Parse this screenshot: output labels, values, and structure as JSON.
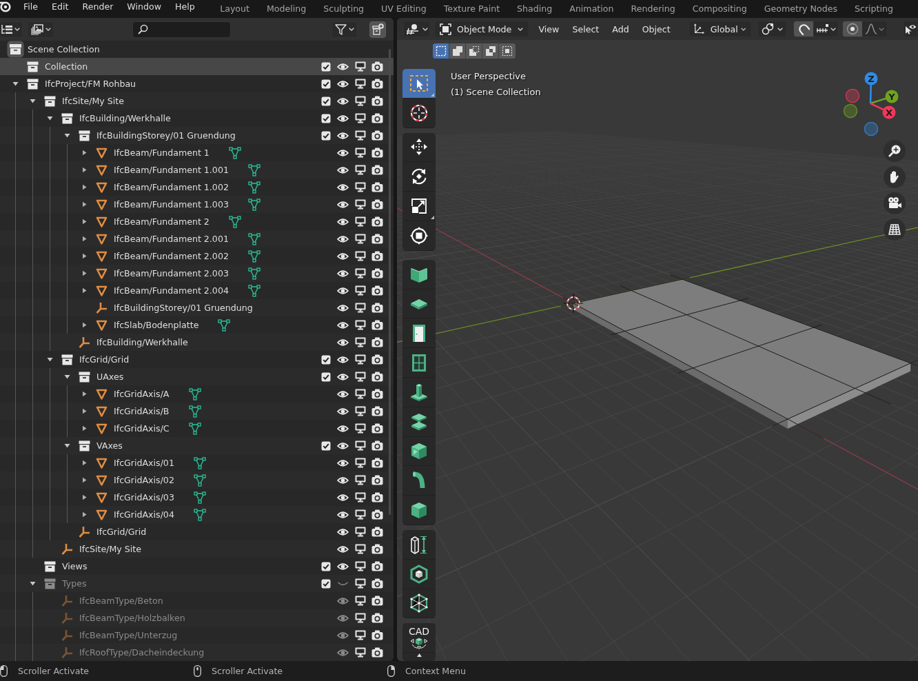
{
  "topbar": {
    "menus": [
      "File",
      "Edit",
      "Render",
      "Window",
      "Help"
    ],
    "workspaces": [
      {
        "label": "Layout",
        "selected": false
      },
      {
        "label": "Modeling",
        "selected": false
      },
      {
        "label": "Sculpting",
        "selected": false
      },
      {
        "label": "UV Editing",
        "selected": false
      },
      {
        "label": "Texture Paint",
        "selected": false
      },
      {
        "label": "Shading",
        "selected": false
      },
      {
        "label": "Animation",
        "selected": false
      },
      {
        "label": "Rendering",
        "selected": false
      },
      {
        "label": "Compositing",
        "selected": false
      },
      {
        "label": "Geometry Nodes",
        "selected": false
      },
      {
        "label": "Scripting",
        "selected": false
      }
    ]
  },
  "outliner": {
    "tree": [
      {
        "name": "Scene Collection",
        "kind": "scene",
        "selected": false,
        "children": [
          {
            "name": "Collection",
            "kind": "collection",
            "selected": true,
            "checked": true,
            "visible": true
          },
          {
            "name": "IfcProject/FM Rohbau",
            "kind": "collection",
            "selected": false,
            "expanded": true,
            "checked": true,
            "visible": true,
            "children": [
              {
                "name": "IfcSite/My Site",
                "kind": "collection",
                "selected": false,
                "expanded": true,
                "checked": true,
                "visible": true,
                "children": [
                  {
                    "name": "IfcBuilding/Werkhalle",
                    "kind": "collection",
                    "selected": false,
                    "expanded": true,
                    "checked": true,
                    "visible": true,
                    "children": [
                      {
                        "name": "IfcBuildingStorey/01 Gruendung",
                        "kind": "collection",
                        "selected": false,
                        "expanded": true,
                        "checked": true,
                        "visible": true,
                        "children": [
                          {
                            "name": "IfcBeam/Fundament 1",
                            "kind": "mesh",
                            "selected": false,
                            "expanded": false,
                            "visible": true
                          },
                          {
                            "name": "IfcBeam/Fundament 1.001",
                            "kind": "mesh",
                            "selected": false,
                            "expanded": false,
                            "visible": true
                          },
                          {
                            "name": "IfcBeam/Fundament 1.002",
                            "kind": "mesh",
                            "selected": false,
                            "expanded": false,
                            "visible": true
                          },
                          {
                            "name": "IfcBeam/Fundament 1.003",
                            "kind": "mesh",
                            "selected": false,
                            "expanded": false,
                            "visible": true
                          },
                          {
                            "name": "IfcBeam/Fundament 2",
                            "kind": "mesh",
                            "selected": false,
                            "expanded": false,
                            "visible": true
                          },
                          {
                            "name": "IfcBeam/Fundament 2.001",
                            "kind": "mesh",
                            "selected": false,
                            "expanded": false,
                            "visible": true
                          },
                          {
                            "name": "IfcBeam/Fundament 2.002",
                            "kind": "mesh",
                            "selected": false,
                            "expanded": false,
                            "visible": true
                          },
                          {
                            "name": "IfcBeam/Fundament 2.003",
                            "kind": "mesh",
                            "selected": false,
                            "expanded": false,
                            "visible": true
                          },
                          {
                            "name": "IfcBeam/Fundament 2.004",
                            "kind": "mesh",
                            "selected": false,
                            "expanded": false,
                            "visible": true
                          },
                          {
                            "name": "IfcBuildingStorey/01 Gruendung",
                            "kind": "empty",
                            "selected": false,
                            "visible": true
                          },
                          {
                            "name": "IfcSlab/Bodenplatte",
                            "kind": "mesh",
                            "selected": false,
                            "expanded": false,
                            "visible": true
                          }
                        ]
                      },
                      {
                        "name": "IfcBuilding/Werkhalle",
                        "kind": "empty",
                        "selected": false,
                        "visible": true
                      }
                    ]
                  },
                  {
                    "name": "IfcGrid/Grid",
                    "kind": "collection",
                    "selected": false,
                    "expanded": true,
                    "checked": true,
                    "visible": true,
                    "children": [
                      {
                        "name": "UAxes",
                        "kind": "collection",
                        "selected": false,
                        "expanded": true,
                        "checked": true,
                        "visible": true,
                        "children": [
                          {
                            "name": "IfcGridAxis/A",
                            "kind": "mesh",
                            "selected": false,
                            "expanded": false,
                            "visible": true
                          },
                          {
                            "name": "IfcGridAxis/B",
                            "kind": "mesh",
                            "selected": false,
                            "expanded": false,
                            "visible": true
                          },
                          {
                            "name": "IfcGridAxis/C",
                            "kind": "mesh",
                            "selected": false,
                            "expanded": false,
                            "visible": true
                          }
                        ]
                      },
                      {
                        "name": "VAxes",
                        "kind": "collection",
                        "selected": false,
                        "expanded": true,
                        "checked": true,
                        "visible": true,
                        "children": [
                          {
                            "name": "IfcGridAxis/01",
                            "kind": "mesh",
                            "selected": false,
                            "expanded": false,
                            "visible": true
                          },
                          {
                            "name": "IfcGridAxis/02",
                            "kind": "mesh",
                            "selected": false,
                            "expanded": false,
                            "visible": true
                          },
                          {
                            "name": "IfcGridAxis/03",
                            "kind": "mesh",
                            "selected": false,
                            "expanded": false,
                            "visible": true
                          },
                          {
                            "name": "IfcGridAxis/04",
                            "kind": "mesh",
                            "selected": false,
                            "expanded": false,
                            "visible": true
                          }
                        ]
                      },
                      {
                        "name": "IfcGrid/Grid",
                        "kind": "empty",
                        "selected": false,
                        "visible": true
                      }
                    ]
                  },
                  {
                    "name": "IfcSite/My Site",
                    "kind": "empty",
                    "selected": false,
                    "visible": true
                  }
                ]
              },
              {
                "name": "Views",
                "kind": "collection",
                "selected": false,
                "checked": true,
                "visible": true
              },
              {
                "name": "Types",
                "kind": "collection",
                "selected": false,
                "expanded": true,
                "checked": true,
                "visible": false,
                "children": [
                  {
                    "name": "IfcBeamType/Beton",
                    "kind": "empty",
                    "selected": false,
                    "visible": true
                  },
                  {
                    "name": "IfcBeamType/Holzbalken",
                    "kind": "empty",
                    "selected": false,
                    "visible": true
                  },
                  {
                    "name": "IfcBeamType/Unterzug",
                    "kind": "empty",
                    "selected": false,
                    "visible": true
                  },
                  {
                    "name": "IfcRoofType/Dacheindeckung",
                    "kind": "empty",
                    "selected": false,
                    "visible": true
                  }
                ]
              }
            ]
          }
        ]
      }
    ]
  },
  "viewport": {
    "header": {
      "mode": "Object Mode",
      "menus": [
        "View",
        "Select",
        "Add",
        "Object"
      ],
      "orientation": "Global",
      "snap": {
        "on": true
      },
      "proportional": {
        "on": true
      }
    },
    "select_modes": [
      {
        "kind": "set",
        "selected": true
      },
      {
        "kind": "extend",
        "selected": false
      },
      {
        "kind": "subtract",
        "selected": false
      },
      {
        "kind": "difference",
        "selected": false
      },
      {
        "kind": "intersect",
        "selected": false
      }
    ],
    "overlay_text": [
      "User Perspective",
      "(1) Scene Collection"
    ],
    "toolbar": {
      "groups": [
        {
          "tools": [
            {
              "kind": "select_box",
              "selected": true
            },
            {
              "kind": "cursor",
              "selected": false
            }
          ]
        },
        {
          "tools": [
            {
              "kind": "move",
              "selected": false
            },
            {
              "kind": "rotate",
              "selected": false
            },
            {
              "kind": "scale",
              "selected": false
            },
            {
              "kind": "transform",
              "selected": false
            }
          ]
        },
        {
          "tools": [
            {
              "kind": "wall",
              "selected": false
            },
            {
              "kind": "slab",
              "selected": false
            },
            {
              "kind": "door",
              "selected": false
            },
            {
              "kind": "window",
              "selected": false
            },
            {
              "kind": "column",
              "selected": false
            },
            {
              "kind": "beam",
              "selected": false
            },
            {
              "kind": "member",
              "selected": false
            },
            {
              "kind": "pipe",
              "selected": false
            },
            {
              "kind": "cube",
              "selected": false
            }
          ]
        },
        {
          "tools": [
            {
              "kind": "extrude",
              "selected": false
            },
            {
              "kind": "hexcube",
              "selected": false
            },
            {
              "kind": "wire",
              "selected": false
            }
          ]
        },
        {
          "tools": [
            {
              "kind": "cad",
              "label": "CAD",
              "selected": false
            }
          ]
        }
      ]
    },
    "gizmo": {
      "axes": [
        {
          "label": "Z",
          "color": "#2e8ce8"
        },
        {
          "label": "Y",
          "color": "#70a41c"
        },
        {
          "label": "X",
          "color": "#f0385a"
        }
      ]
    }
  },
  "status_bar": [
    {
      "kind": "left",
      "text": "Scroller Activate"
    },
    {
      "kind": "middle",
      "text": "Scroller Activate"
    },
    {
      "kind": "right",
      "text": "Context Menu"
    }
  ]
}
